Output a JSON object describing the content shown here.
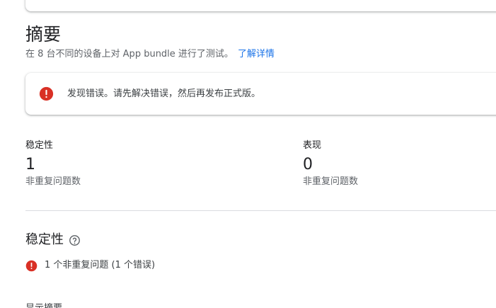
{
  "summary": {
    "title": "摘要",
    "subtitle": "在 8 台不同的设备上对 App bundle 进行了测试。",
    "learn_more": "了解详情"
  },
  "error_banner": {
    "message": "发现错误。请先解决错误，然后再发布正式版。",
    "icon": "error-icon",
    "color": "#d93025"
  },
  "metrics": {
    "stability": {
      "label": "稳定性",
      "value": "1",
      "caption": "非重复问题数"
    },
    "performance": {
      "label": "表现",
      "value": "0",
      "caption": "非重复问题数"
    }
  },
  "stability_section": {
    "title": "稳定性",
    "help_icon": "help-circle-icon",
    "issue_summary": "1 个非重复问题 (1 个错误)",
    "next_heading_partial": "显示摘要"
  },
  "colors": {
    "link": "#1a73e8",
    "error": "#d93025"
  }
}
